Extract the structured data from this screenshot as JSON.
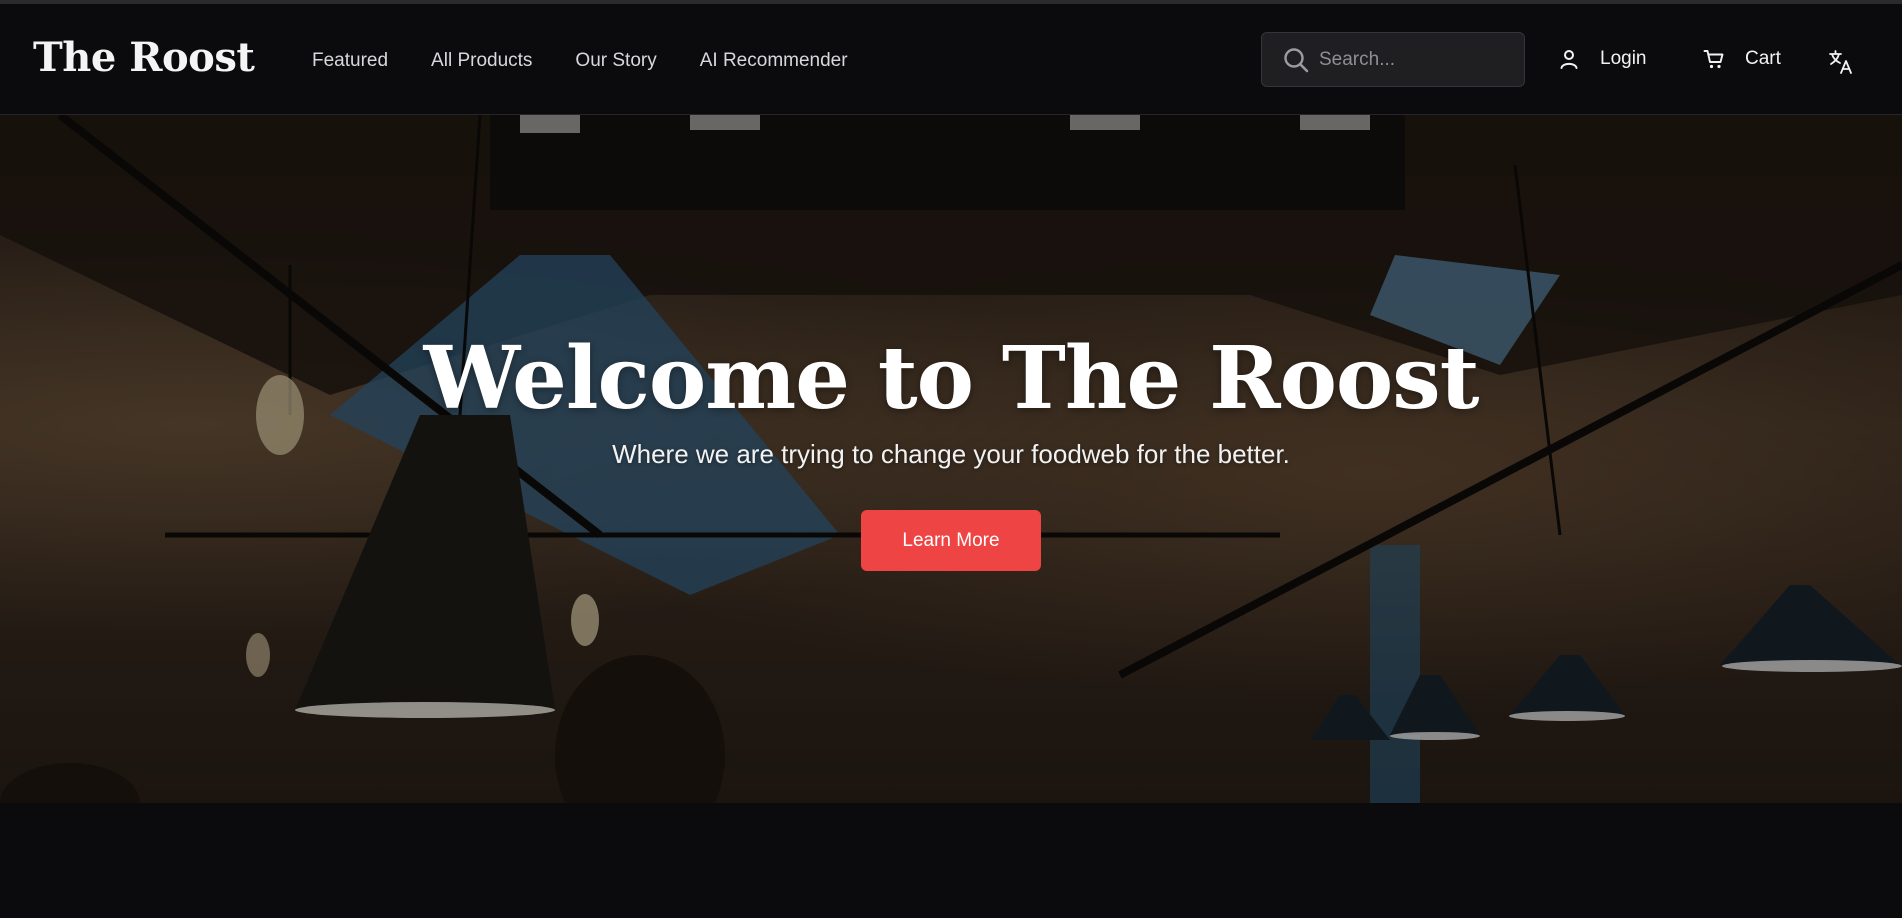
{
  "brand": {
    "name": "The Roost"
  },
  "nav": {
    "links": [
      {
        "label": "Featured"
      },
      {
        "label": "All Products"
      },
      {
        "label": "Our Story"
      },
      {
        "label": "AI Recommender"
      }
    ]
  },
  "search": {
    "placeholder": "Search...",
    "value": ""
  },
  "actions": {
    "login_label": "Login",
    "cart_label": "Cart"
  },
  "icons": {
    "search": "search-icon",
    "login": "user-icon",
    "cart": "cart-icon",
    "translate": "translate-icon"
  },
  "hero": {
    "title": "Welcome to The Roost",
    "subtitle": "Where we are trying to change your foodweb for the better.",
    "button_label": "Learn More"
  },
  "colors": {
    "background": "#0b0b0d",
    "accent": "#ef4444",
    "search_bg": "#1f1f22"
  }
}
